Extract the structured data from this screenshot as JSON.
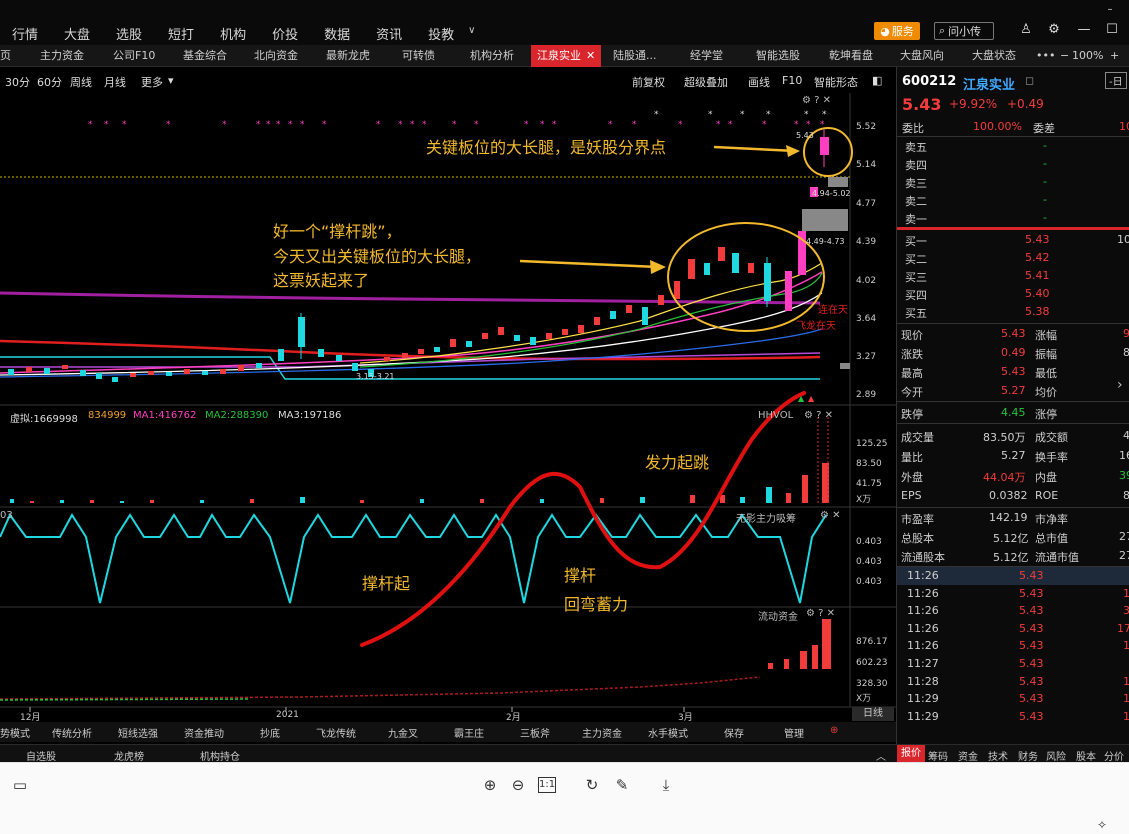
{
  "top_menu": [
    "行情",
    "大盘",
    "选股",
    "短打",
    "机构",
    "价投",
    "数据",
    "资讯",
    "投教"
  ],
  "service_btn": "服务",
  "ask_placeholder": "问小传",
  "tabs": [
    "页",
    "主力资金",
    "公司F10",
    "基金综合",
    "北向资金",
    "最新龙虎",
    "可转债",
    "机构分析",
    "江泉实业",
    "陆股通...",
    "经学堂",
    "智能选股",
    "乾坤看盘",
    "大盘风向",
    "大盘状态"
  ],
  "active_tab": "江泉实业",
  "zoom": "100%",
  "chart_toolbar": {
    "periods": [
      "30分",
      "60分",
      "周线",
      "月线",
      "更多"
    ],
    "right": [
      "前复权",
      "超级叠加",
      "画线",
      "F10",
      "智能形态"
    ]
  },
  "price_scale": [
    "5.52",
    "5.14",
    "4.77",
    "4.39",
    "4.02",
    "3.64",
    "3.27",
    "2.89"
  ],
  "price_marks": {
    "high": "5.43",
    "range_top": "4.94-5.02",
    "range_mid": "4.49-4.73",
    "range_low": "3.15-3.21"
  },
  "red_tags": [
    "连在天",
    "飞龙在天"
  ],
  "annotations": {
    "line1": "关键板位的大长腿，是妖股分界点",
    "line2a": "好一个“撑杆跳”，",
    "line2b": "今天又出关键板位的大长腿，",
    "line2c": "这票妖起来了",
    "jump": "发力起跳",
    "pole": "撑杆起",
    "bend1": "撑杆",
    "bend2": "回弯蓄力"
  },
  "volume_panel": {
    "title_parts": [
      "虚拟:1669998",
      "834999",
      "MA1:416762",
      "MA2:288390",
      "MA3:197186"
    ],
    "right_title": "HHVOL",
    "scale": [
      "125.25",
      "83.50",
      "41.75",
      "X万"
    ]
  },
  "osc_panel": {
    "left_label": "03",
    "right_title": "无影主力吸筹",
    "scale": [
      "0.403",
      "0.403",
      "0.403"
    ]
  },
  "flow_panel": {
    "right_title": "流动资金",
    "scale": [
      "876.17",
      "602.23",
      "328.30",
      "X万"
    ]
  },
  "x_axis": [
    "12月",
    "2021",
    "2月",
    "3月"
  ],
  "daily_btn": "日线",
  "bottom_tabs1": [
    "势模式",
    "传统分析",
    "短线选强",
    "资金推动",
    "抄底",
    "飞龙传统",
    "九金叉",
    "霸王庄",
    "三板斧",
    "主力资金",
    "水手模式",
    "保存",
    "管理"
  ],
  "bottom_tabs2": [
    "自选股",
    "龙虎榜",
    "机构持仓"
  ],
  "right_tabs": [
    "报价",
    "筹码",
    "资金",
    "技术",
    "财务",
    "风险",
    "股本",
    "分价"
  ],
  "stock": {
    "code": "600212",
    "name": "江泉实业",
    "price": "5.43",
    "pct": "+9.92%",
    "change": "+0.49",
    "wb_label": "委比",
    "wb": "100.00%",
    "wc_label": "委差",
    "wc": "10"
  },
  "asks": [
    {
      "label": "卖五",
      "price": "-"
    },
    {
      "label": "卖四",
      "price": "-"
    },
    {
      "label": "卖三",
      "price": "-"
    },
    {
      "label": "卖二",
      "price": "-"
    },
    {
      "label": "卖一",
      "price": "-"
    }
  ],
  "bids": [
    {
      "label": "买一",
      "price": "5.43",
      "vol": "10"
    },
    {
      "label": "买二",
      "price": "5.42",
      "vol": ""
    },
    {
      "label": "买三",
      "price": "5.41",
      "vol": ""
    },
    {
      "label": "买四",
      "price": "5.40",
      "vol": ""
    },
    {
      "label": "买五",
      "price": "5.38",
      "vol": ""
    }
  ],
  "quote": [
    {
      "a": "现价",
      "av": "5.43",
      "b": "涨幅",
      "bv": "9"
    },
    {
      "a": "涨跌",
      "av": "0.49",
      "b": "振幅",
      "bv": "8"
    },
    {
      "a": "最高",
      "av": "5.43",
      "b": "最低",
      "bv": ""
    },
    {
      "a": "今开",
      "av": "5.27",
      "b": "均价",
      "bv": ""
    },
    {
      "a": "跌停",
      "av": "4.45",
      "b": "涨停",
      "bv": ""
    },
    {
      "a": "成交量",
      "av": "83.50万",
      "b": "成交额",
      "bv": "4"
    },
    {
      "a": "量比",
      "av": "5.27",
      "b": "换手率",
      "bv": "16"
    },
    {
      "a": "外盘",
      "av": "44.04万",
      "b": "内盘",
      "bv": "39"
    },
    {
      "a": "EPS",
      "av": "0.0382",
      "b": "ROE",
      "bv": "8"
    },
    {
      "a": "市盈率",
      "av": "142.19",
      "b": "市净率",
      "bv": ""
    },
    {
      "a": "总股本",
      "av": "5.12亿",
      "b": "总市值",
      "bv": "27"
    },
    {
      "a": "流通股本",
      "av": "5.12亿",
      "b": "流通市值",
      "bv": "27"
    }
  ],
  "ticks": [
    {
      "t": "11:26",
      "p": "5.43",
      "v": ""
    },
    {
      "t": "11:26",
      "p": "5.43",
      "v": "1"
    },
    {
      "t": "11:26",
      "p": "5.43",
      "v": "3"
    },
    {
      "t": "11:26",
      "p": "5.43",
      "v": "17"
    },
    {
      "t": "11:26",
      "p": "5.43",
      "v": "1"
    },
    {
      "t": "11:27",
      "p": "5.43",
      "v": ""
    },
    {
      "t": "11:28",
      "p": "5.43",
      "v": "1"
    },
    {
      "t": "11:29",
      "p": "5.43",
      "v": "1"
    },
    {
      "t": "11:29",
      "p": "5.43",
      "v": "1"
    }
  ],
  "colors": {
    "up": "#f23c3c",
    "down": "#27c23a",
    "accent": "#d9262c",
    "annotation": "#f2b92d",
    "cyan": "#20d8e0"
  }
}
